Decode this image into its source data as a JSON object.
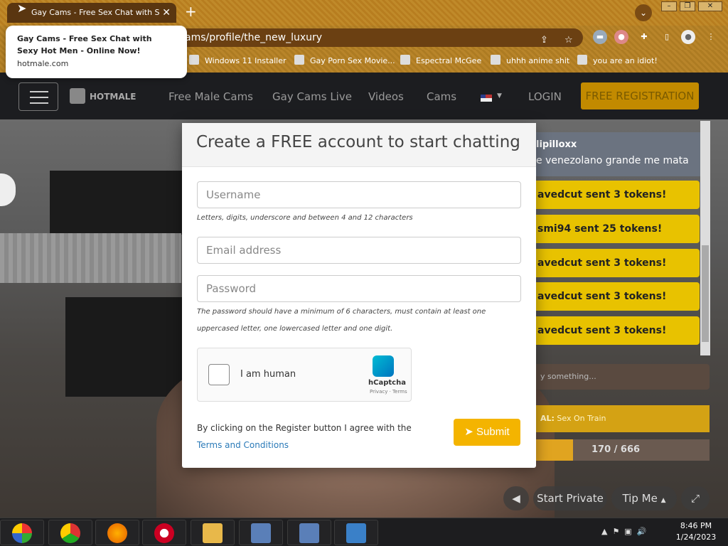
{
  "browser": {
    "tab_title": "Gay Cams - Free Sex Chat with S",
    "tab_close": "✕",
    "new_tab": "+",
    "url": "ams/profile/the_new_luxury",
    "tooltip": {
      "title_line1": "Gay Cams - Free Sex Chat with",
      "title_line2": "Sexy Hot Men - Online Now!",
      "domain": "hotmale.com"
    },
    "bookmarks": [
      "Windows 11 Installer",
      "Gay Porn Sex Movie...",
      "Espectral McGee",
      "uhhh anime shit",
      "you are an idiot!"
    ]
  },
  "nav": {
    "logo": "HOTMALE",
    "links": [
      "Free Male Cams",
      "Gay Cams Live",
      "Videos",
      "Cams"
    ],
    "login": "LOGIN",
    "register": "FREE REGISTRATION"
  },
  "chat": {
    "user": "lipilloxx",
    "user_msg": "e venezolano grande me mata",
    "tips": [
      "avedcut sent 3 tokens!",
      "smi94 sent 25 tokens!",
      "avedcut sent 3 tokens!",
      "avedcut sent 3 tokens!",
      "avedcut sent 3 tokens!"
    ],
    "input_placeholder": "y something...",
    "goal_label": "AL:",
    "goal_text": "Sex On Train",
    "progress": "170 / 666",
    "progress_fraction": 0.255
  },
  "video_controls": {
    "start_private": "Start Private",
    "tip_me": "Tip Me"
  },
  "modal": {
    "title": "Create a FREE account to start chatting",
    "username_placeholder": "Username",
    "username_help": "Letters, digits, underscore and between 4 and 12 characters",
    "email_placeholder": "Email address",
    "password_placeholder": "Password",
    "password_help": "The password should have a minimum of 6 characters, must contain at least one uppercased letter, one lowercased letter and one digit.",
    "captcha_label": "I am human",
    "captcha_brand": "hCaptcha",
    "captcha_links": "Privacy · Terms",
    "agree_text": "By clicking on the Register button I agree with the",
    "terms_link": "Terms and Conditions",
    "submit": "Submit"
  },
  "taskbar": {
    "time": "8:46 PM",
    "date": "1/24/2023"
  }
}
